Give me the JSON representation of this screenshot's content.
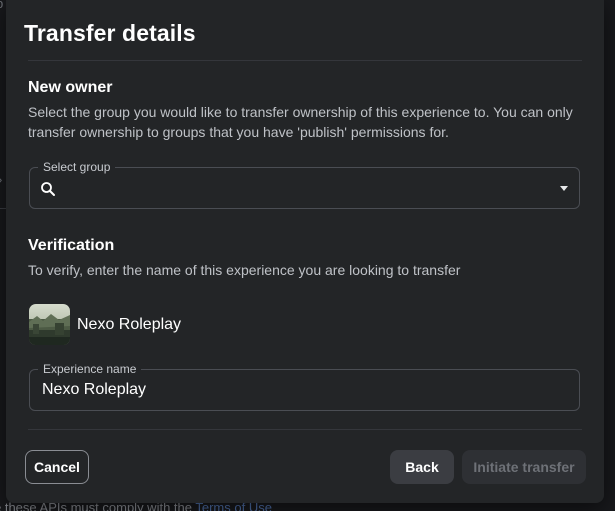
{
  "dialog": {
    "title": "Transfer details"
  },
  "new_owner": {
    "heading": "New owner",
    "description": "Select the group you would like to transfer ownership of this experience to. You can only transfer ownership to groups that you have 'publish' permissions for.",
    "select_label": "Select group",
    "select_value": "",
    "search_icon": "search-icon",
    "dropdown_icon": "caret-down-icon"
  },
  "verification": {
    "heading": "Verification",
    "description": "To verify, enter the name of this experience you are looking to transfer",
    "experience_title": "Nexo Roleplay",
    "input_label": "Experience name",
    "input_value": "Nexo Roleplay"
  },
  "actions": {
    "cancel_label": "Cancel",
    "back_label": "Back",
    "initiate_label": "Initiate transfer",
    "initiate_enabled": false
  },
  "background": {
    "footer_text": "e these APIs must comply with the ",
    "footer_link": "Terms of Use"
  },
  "colors": {
    "modal_bg": "#232527",
    "page_bg": "#18191c",
    "text_primary": "#ffffff",
    "text_secondary": "#bfc2c7",
    "field_border": "#4a4d53",
    "disabled_button_bg": "#2e3034",
    "disabled_button_text": "#6e7177"
  }
}
